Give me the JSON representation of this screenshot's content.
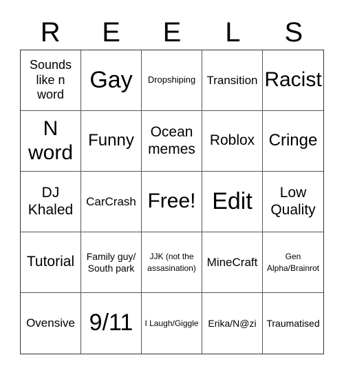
{
  "title_letters": [
    "R",
    "E",
    "E",
    "L",
    "S"
  ],
  "cells": [
    {
      "text": "Sounds like n word",
      "size": "s-ms"
    },
    {
      "text": "Gay",
      "size": "s-xl"
    },
    {
      "text": "Dropshiping",
      "size": "s-xxs"
    },
    {
      "text": "Transition",
      "size": "s-s"
    },
    {
      "text": "Racist",
      "size": "s-lg"
    },
    {
      "text": "N word",
      "size": "s-lg"
    },
    {
      "text": "Funny",
      "size": "s-ml"
    },
    {
      "text": "Ocean memes",
      "size": "s-m"
    },
    {
      "text": "Roblox",
      "size": "s-m"
    },
    {
      "text": "Cringe",
      "size": "s-ml"
    },
    {
      "text": "DJ Khaled",
      "size": "s-m"
    },
    {
      "text": "CarCrash",
      "size": "s-s"
    },
    {
      "text": "Free!",
      "size": "s-lg"
    },
    {
      "text": "Edit",
      "size": "s-xl"
    },
    {
      "text": "Low Quality",
      "size": "s-m"
    },
    {
      "text": "Tutorial",
      "size": "s-m"
    },
    {
      "text": "Family guy/ South park",
      "size": "s-xs"
    },
    {
      "text": "JJK (not the assasination)",
      "size": "s-t"
    },
    {
      "text": "MineCraft",
      "size": "s-s"
    },
    {
      "text": "Gen Alpha/Brainrot",
      "size": "s-t"
    },
    {
      "text": "Ovensive",
      "size": "s-s"
    },
    {
      "text": "9/11",
      "size": "s-xl"
    },
    {
      "text": "I Laugh/Giggle",
      "size": "s-t"
    },
    {
      "text": "Erika/N@zi",
      "size": "s-xs"
    },
    {
      "text": "Traumatised",
      "size": "s-xs"
    }
  ]
}
